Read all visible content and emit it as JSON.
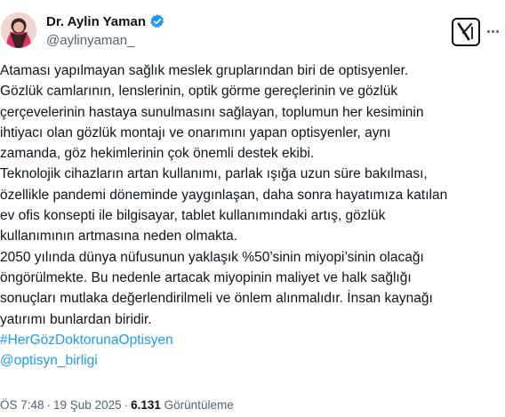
{
  "author": {
    "display_name": "Dr. Aylin Yaman",
    "handle": "@aylinyaman_"
  },
  "body_lines": [
    "Ataması yapılmayan sağlık meslek gruplarından biri de optisyenler.",
    "Gözlük camlarının, lenslerinin, optik görme gereçlerinin ve gözlük",
    "çerçevelerinin hastaya sunulmasını sağlayan, toplumun her kesiminin",
    "ihtiyacı olan gözlük montajı ve onarımını yapan optisyenler, aynı",
    "zamanda, göz hekimlerinin çok önemli destek ekibi.",
    "Teknolojik cihazların artan kullanımı, parlak ışığa uzun süre bakılması,",
    "özellikle pandemi döneminde yaygınlaşan, daha sonra hayatımıza katılan",
    "ev ofis konsepti ile bilgisayar, tablet kullanımındaki artış, gözlük",
    "kullanımının artmasına neden olmakta.",
    "2050 yılında dünya nüfusunun yaklaşık %50’sinin miyopi’sinin olacağı",
    "öngörülmekte. Bu nedenle artacak miyopinin maliyet ve halk sağlığı",
    "sonuçları mutlaka değerlendirilmeli ve önlem alınmalıdır. İnsan kaynağı",
    "yatırımı bunlardan biridir."
  ],
  "links": {
    "hashtag": "#HerGözDoktorunaOptisyen",
    "mention": "@optisyn_birligi"
  },
  "meta": {
    "time": "ÖS 7:48",
    "separator": "·",
    "date": "19 Şub 2025",
    "views_count": "6.131",
    "views_label": "Görüntüleme"
  },
  "colors": {
    "link": "#1d9bf0",
    "verified": "#1d9bf0",
    "secondary_text": "#536471",
    "primary_text": "#0f1419"
  },
  "icons": [
    "verified-badge-icon",
    "x-logo-icon",
    "more-options-icon"
  ]
}
